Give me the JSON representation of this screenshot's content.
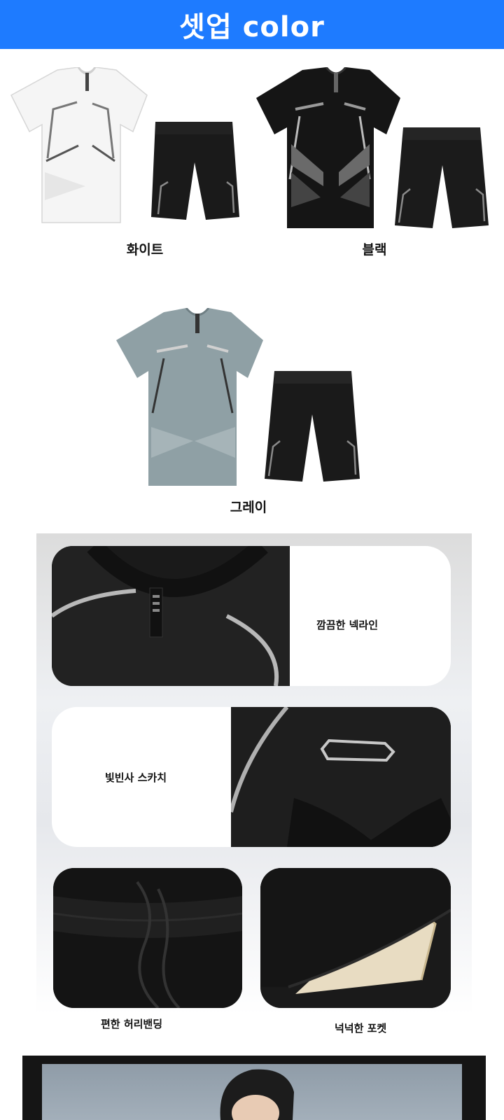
{
  "header": {
    "title": "셋업 color",
    "bg": "#1e7bff"
  },
  "products": [
    {
      "name": "화이트",
      "shirt_color": "#f4f4f4",
      "shorts_color": "#1a1a1a"
    },
    {
      "name": "블랙",
      "shirt_color": "#161616",
      "shorts_color": "#1a1a1a"
    },
    {
      "name": "그레이",
      "shirt_color": "#8fa0a5",
      "shorts_color": "#1a1a1a"
    }
  ],
  "features": [
    {
      "label": "깜끔한 넥라인",
      "icon": "neckline-photo"
    },
    {
      "label": "빛빈사 스카치",
      "icon": "reflective-stripe-photo"
    },
    {
      "label": "편한 허리밴딩",
      "icon": "waistband-photo"
    },
    {
      "label": "넉넉한 포켓",
      "icon": "pocket-photo"
    }
  ]
}
